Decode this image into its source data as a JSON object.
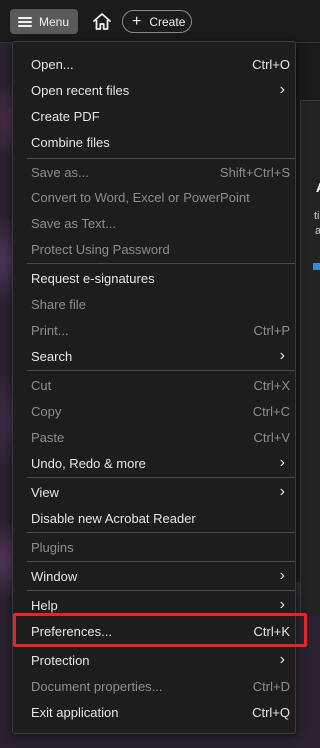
{
  "topbar": {
    "menu_label": "Menu",
    "create_label": "Create"
  },
  "side_panel": {
    "letters": [
      "A",
      "ti",
      "a"
    ]
  },
  "menu": {
    "items": [
      {
        "label": "Open...",
        "shortcut": "Ctrl+O",
        "disabled": false
      },
      {
        "label": "Open recent files",
        "submenu": true,
        "disabled": false
      },
      {
        "label": "Create PDF",
        "disabled": false
      },
      {
        "label": "Combine files",
        "disabled": false
      },
      {
        "label": "Save as...",
        "shortcut": "Shift+Ctrl+S",
        "disabled": true
      },
      {
        "label": "Convert to Word, Excel or PowerPoint",
        "disabled": true
      },
      {
        "label": "Save as Text...",
        "disabled": true
      },
      {
        "label": "Protect Using Password",
        "disabled": true
      },
      {
        "label": "Request e-signatures",
        "disabled": false
      },
      {
        "label": "Share file",
        "disabled": true
      },
      {
        "label": "Print...",
        "shortcut": "Ctrl+P",
        "disabled": true
      },
      {
        "label": "Search",
        "submenu": true,
        "disabled": false
      },
      {
        "label": "Cut",
        "shortcut": "Ctrl+X",
        "disabled": true
      },
      {
        "label": "Copy",
        "shortcut": "Ctrl+C",
        "disabled": true
      },
      {
        "label": "Paste",
        "shortcut": "Ctrl+V",
        "disabled": true
      },
      {
        "label": "Undo, Redo & more",
        "submenu": true,
        "disabled": false
      },
      {
        "label": "View",
        "submenu": true,
        "disabled": false
      },
      {
        "label": "Disable new Acrobat Reader",
        "disabled": false
      },
      {
        "label": "Plugins",
        "disabled": true
      },
      {
        "label": "Window",
        "submenu": true,
        "disabled": false
      },
      {
        "label": "Help",
        "submenu": true,
        "disabled": false
      },
      {
        "label": "Preferences...",
        "shortcut": "Ctrl+K",
        "disabled": false,
        "highlighted": true
      },
      {
        "label": "Protection",
        "submenu": true,
        "disabled": false
      },
      {
        "label": "Document properties...",
        "shortcut": "Ctrl+D",
        "disabled": true
      },
      {
        "label": "Exit application",
        "shortcut": "Ctrl+Q",
        "disabled": false
      }
    ]
  },
  "colors": {
    "highlight_border": "#e5242b",
    "disabled_text": "#8d8d8d"
  }
}
